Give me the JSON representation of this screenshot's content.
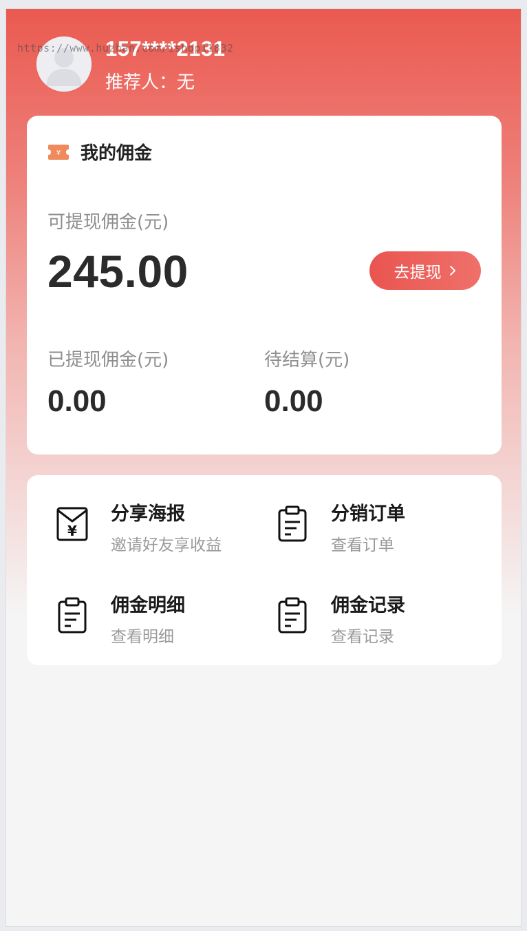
{
  "header": {
    "watermark": "https://www.huzhan.com/ishop11832",
    "phone": "157****2131",
    "referrer": "推荐人：无"
  },
  "commission": {
    "title": "我的佣金",
    "withdrawable_label": "可提现佣金(元)",
    "withdrawable_amount": "245.00",
    "withdraw_button": "去提现",
    "withdrawn_label": "已提现佣金(元)",
    "withdrawn_amount": "0.00",
    "pending_label": "待结算(元)",
    "pending_amount": "0.00"
  },
  "menu": {
    "items": [
      {
        "title": "分享海报",
        "subtitle": "邀请好友享收益",
        "icon": "poster-envelope-icon"
      },
      {
        "title": "分销订单",
        "subtitle": "查看订单",
        "icon": "clipboard-icon"
      },
      {
        "title": "佣金明细",
        "subtitle": "查看明细",
        "icon": "clipboard-icon"
      },
      {
        "title": "佣金记录",
        "subtitle": "查看记录",
        "icon": "clipboard-icon"
      }
    ]
  },
  "colors": {
    "brand_red": "#ea5a50",
    "ticket_orange": "#ef8a5c"
  }
}
